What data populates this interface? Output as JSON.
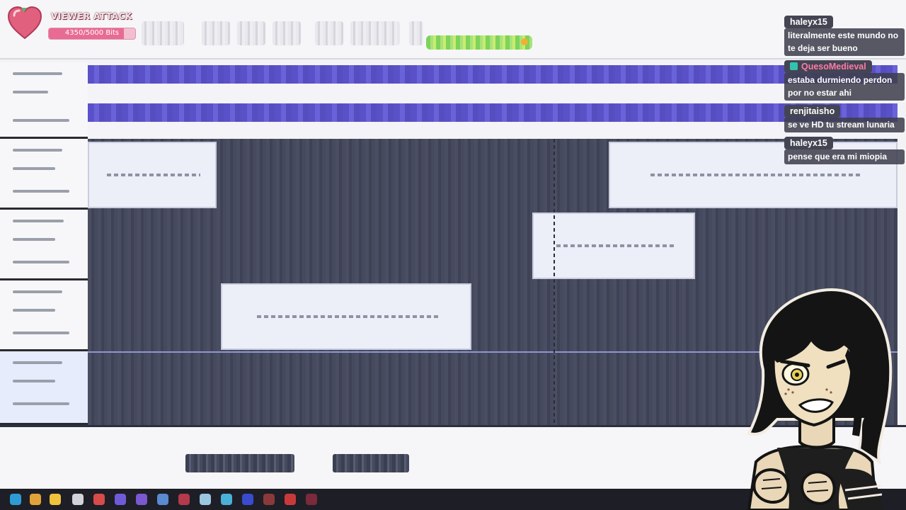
{
  "viewer_attack": {
    "title": "VIEWER ATTACK",
    "progress_text": "4350/5000 Bits",
    "progress_fraction": 0.87,
    "accent_color": "#e86b93"
  },
  "chat": {
    "messages": [
      {
        "user": "haleyx15",
        "text": "literalmente este mundo no te deja ser bueno",
        "user_color": "#ffffff",
        "badge": false
      },
      {
        "user": "QuesoMedieval",
        "text": "estaba durmiendo perdon por no estar ahi",
        "user_color": "#ff7aa8",
        "badge": true
      },
      {
        "user": "renjitaisho",
        "text": "se ve HD tu stream lunaria",
        "user_color": "#ffffff",
        "badge": false
      },
      {
        "user": "haleyx15",
        "text": "pense que era mi miopia",
        "user_color": "#ffffff",
        "badge": false
      }
    ]
  },
  "colors": {
    "banner_band": "#5a51c8",
    "grid_dark": "#464a5e",
    "slot_light": "#eceef8"
  },
  "icons": [
    "heart-icon",
    "chat-badge-icon",
    "taskbar-app-icon"
  ]
}
